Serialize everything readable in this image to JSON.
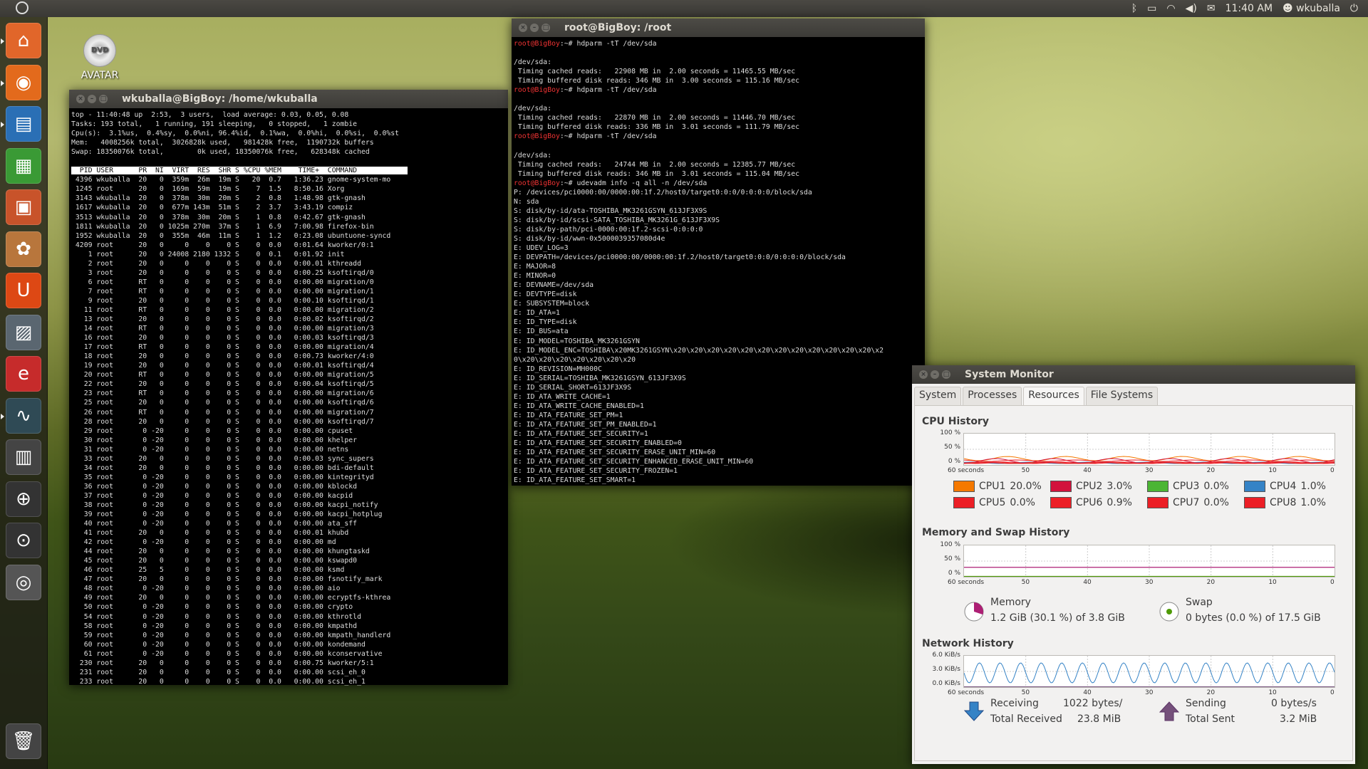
{
  "top_panel": {
    "time": "11:40 AM",
    "user": "wkuballa",
    "icons": [
      "bluetooth-icon",
      "battery-icon",
      "wifi-icon",
      "volume-icon",
      "mail-icon",
      "user-icon",
      "power-icon"
    ]
  },
  "desktop": {
    "dvd_label": "AVATAR",
    "dvd_badge": "DVD"
  },
  "term_top": {
    "title": "wkuballa@BigBoy: /home/wkuballa",
    "summary": [
      "top - 11:40:48 up  2:53,  3 users,  load average: 0.03, 0.05, 0.08",
      "Tasks: 193 total,   1 running, 191 sleeping,   0 stopped,   1 zombie",
      "Cpu(s):  3.1%us,  0.4%sy,  0.0%ni, 96.4%id,  0.1%wa,  0.0%hi,  0.0%si,  0.0%st",
      "Mem:   4008256k total,  3026828k used,   981428k free,  1190732k buffers",
      "Swap: 18350076k total,        0k used, 18350076k free,   628348k cached"
    ],
    "header": "  PID USER      PR  NI  VIRT  RES  SHR S %CPU %MEM    TIME+  COMMAND            ",
    "rows": [
      " 4396 wkuballa  20   0  359m  26m  19m S   20  0.7   1:36.23 gnome-system-mo",
      " 1245 root      20   0  169m  59m  19m S    7  1.5   8:50.16 Xorg",
      " 3143 wkuballa  20   0  378m  30m  20m S    2  0.8   1:48.98 gtk-gnash",
      " 1617 wkuballa  20   0  677m 143m  51m S    2  3.7   3:43.19 compiz",
      " 3513 wkuballa  20   0  378m  30m  20m S    1  0.8   0:42.67 gtk-gnash",
      " 1811 wkuballa  20   0 1025m 270m  37m S    1  6.9   7:00.98 firefox-bin",
      " 1952 wkuballa  20   0  355m  46m  11m S    1  1.2   0:23.08 ubuntuone-syncd",
      " 4209 root      20   0     0    0    0 S    0  0.0   0:01.64 kworker/0:1",
      "    1 root      20   0 24008 2180 1332 S    0  0.1   0:01.92 init",
      "    2 root      20   0     0    0    0 S    0  0.0   0:00.01 kthreadd",
      "    3 root      20   0     0    0    0 S    0  0.0   0:00.25 ksoftirqd/0",
      "    6 root      RT   0     0    0    0 S    0  0.0   0:00.00 migration/0",
      "    7 root      RT   0     0    0    0 S    0  0.0   0:00.00 migration/1",
      "    9 root      20   0     0    0    0 S    0  0.0   0:00.10 ksoftirqd/1",
      "   11 root      RT   0     0    0    0 S    0  0.0   0:00.00 migration/2",
      "   13 root      20   0     0    0    0 S    0  0.0   0:00.02 ksoftirqd/2",
      "   14 root      RT   0     0    0    0 S    0  0.0   0:00.00 migration/3",
      "   16 root      20   0     0    0    0 S    0  0.0   0:00.03 ksoftirqd/3",
      "   17 root      RT   0     0    0    0 S    0  0.0   0:00.00 migration/4",
      "   18 root      20   0     0    0    0 S    0  0.0   0:00.73 kworker/4:0",
      "   19 root      20   0     0    0    0 S    0  0.0   0:00.01 ksoftirqd/4",
      "   20 root      RT   0     0    0    0 S    0  0.0   0:00.00 migration/5",
      "   22 root      20   0     0    0    0 S    0  0.0   0:00.04 ksoftirqd/5",
      "   23 root      RT   0     0    0    0 S    0  0.0   0:00.00 migration/6",
      "   25 root      20   0     0    0    0 S    0  0.0   0:00.00 ksoftirqd/6",
      "   26 root      RT   0     0    0    0 S    0  0.0   0:00.00 migration/7",
      "   28 root      20   0     0    0    0 S    0  0.0   0:00.00 ksoftirqd/7",
      "   29 root       0 -20     0    0    0 S    0  0.0   0:00.00 cpuset",
      "   30 root       0 -20     0    0    0 S    0  0.0   0:00.00 khelper",
      "   31 root       0 -20     0    0    0 S    0  0.0   0:00.00 netns",
      "   33 root      20   0     0    0    0 S    0  0.0   0:00.03 sync_supers",
      "   34 root      20   0     0    0    0 S    0  0.0   0:00.00 bdi-default",
      "   35 root       0 -20     0    0    0 S    0  0.0   0:00.00 kintegrityd",
      "   36 root       0 -20     0    0    0 S    0  0.0   0:00.00 kblockd",
      "   37 root       0 -20     0    0    0 S    0  0.0   0:00.00 kacpid",
      "   38 root       0 -20     0    0    0 S    0  0.0   0:00.00 kacpi_notify",
      "   39 root       0 -20     0    0    0 S    0  0.0   0:00.00 kacpi_hotplug",
      "   40 root       0 -20     0    0    0 S    0  0.0   0:00.00 ata_sff",
      "   41 root      20   0     0    0    0 S    0  0.0   0:00.01 khubd",
      "   42 root       0 -20     0    0    0 S    0  0.0   0:00.00 md",
      "   44 root      20   0     0    0    0 S    0  0.0   0:00.00 khungtaskd",
      "   45 root      20   0     0    0    0 S    0  0.0   0:00.00 kswapd0",
      "   46 root      25   5     0    0    0 S    0  0.0   0:00.00 ksmd",
      "   47 root      20   0     0    0    0 S    0  0.0   0:00.00 fsnotify_mark",
      "   48 root       0 -20     0    0    0 S    0  0.0   0:00.00 aio",
      "   49 root      20   0     0    0    0 S    0  0.0   0:00.00 ecryptfs-kthrea",
      "   50 root       0 -20     0    0    0 S    0  0.0   0:00.00 crypto",
      "   54 root       0 -20     0    0    0 S    0  0.0   0:00.00 kthrotld",
      "   58 root       0 -20     0    0    0 S    0  0.0   0:00.00 kmpathd",
      "   59 root       0 -20     0    0    0 S    0  0.0   0:00.00 kmpath_handlerd",
      "   60 root       0 -20     0    0    0 S    0  0.0   0:00.00 kondemand",
      "   61 root       0 -20     0    0    0 S    0  0.0   0:00.00 kconservative",
      "  230 root      20   0     0    0    0 S    0  0.0   0:00.75 kworker/5:1",
      "  231 root      20   0     0    0    0 S    0  0.0   0:00.00 scsi_eh_0",
      "  233 root      20   0     0    0    0 S    0  0.0   0:00.00 scsi_eh_1"
    ]
  },
  "term_root": {
    "title": "root@BigBoy: /root",
    "prompt_user": "root",
    "prompt_host": "BigBoy",
    "prompt_suffix": ":~# ",
    "lines": [
      {
        "prompt": true,
        "text": "hdparm -tT /dev/sda"
      },
      {
        "prompt": false,
        "text": ""
      },
      {
        "prompt": false,
        "text": "/dev/sda:"
      },
      {
        "prompt": false,
        "text": " Timing cached reads:   22908 MB in  2.00 seconds = 11465.55 MB/sec"
      },
      {
        "prompt": false,
        "text": " Timing buffered disk reads: 346 MB in  3.00 seconds = 115.16 MB/sec"
      },
      {
        "prompt": true,
        "text": "hdparm -tT /dev/sda"
      },
      {
        "prompt": false,
        "text": ""
      },
      {
        "prompt": false,
        "text": "/dev/sda:"
      },
      {
        "prompt": false,
        "text": " Timing cached reads:   22870 MB in  2.00 seconds = 11446.70 MB/sec"
      },
      {
        "prompt": false,
        "text": " Timing buffered disk reads: 336 MB in  3.01 seconds = 111.79 MB/sec"
      },
      {
        "prompt": true,
        "text": "hdparm -tT /dev/sda"
      },
      {
        "prompt": false,
        "text": ""
      },
      {
        "prompt": false,
        "text": "/dev/sda:"
      },
      {
        "prompt": false,
        "text": " Timing cached reads:   24744 MB in  2.00 seconds = 12385.77 MB/sec"
      },
      {
        "prompt": false,
        "text": " Timing buffered disk reads: 346 MB in  3.01 seconds = 115.04 MB/sec"
      },
      {
        "prompt": true,
        "text": "udevadm info -q all -n /dev/sda"
      },
      {
        "prompt": false,
        "text": "P: /devices/pci0000:00/0000:00:1f.2/host0/target0:0:0/0:0:0:0/block/sda"
      },
      {
        "prompt": false,
        "text": "N: sda"
      },
      {
        "prompt": false,
        "text": "S: disk/by-id/ata-TOSHIBA_MK3261GSYN_613JF3X9S"
      },
      {
        "prompt": false,
        "text": "S: disk/by-id/scsi-SATA_TOSHIBA_MK3261G_613JF3X9S"
      },
      {
        "prompt": false,
        "text": "S: disk/by-path/pci-0000:00:1f.2-scsi-0:0:0:0"
      },
      {
        "prompt": false,
        "text": "S: disk/by-id/wwn-0x5000039357080d4e"
      },
      {
        "prompt": false,
        "text": "E: UDEV_LOG=3"
      },
      {
        "prompt": false,
        "text": "E: DEVPATH=/devices/pci0000:00/0000:00:1f.2/host0/target0:0:0/0:0:0:0/block/sda"
      },
      {
        "prompt": false,
        "text": "E: MAJOR=8"
      },
      {
        "prompt": false,
        "text": "E: MINOR=0"
      },
      {
        "prompt": false,
        "text": "E: DEVNAME=/dev/sda"
      },
      {
        "prompt": false,
        "text": "E: DEVTYPE=disk"
      },
      {
        "prompt": false,
        "text": "E: SUBSYSTEM=block"
      },
      {
        "prompt": false,
        "text": "E: ID_ATA=1"
      },
      {
        "prompt": false,
        "text": "E: ID_TYPE=disk"
      },
      {
        "prompt": false,
        "text": "E: ID_BUS=ata"
      },
      {
        "prompt": false,
        "text": "E: ID_MODEL=TOSHIBA_MK3261GSYN"
      },
      {
        "prompt": false,
        "text": "E: ID_MODEL_ENC=TOSHIBA\\x20MK3261GSYN\\x20\\x20\\x20\\x20\\x20\\x20\\x20\\x20\\x20\\x20\\x20\\x20\\x2"
      },
      {
        "prompt": false,
        "text": "0\\x20\\x20\\x20\\x20\\x20\\x20\\x20"
      },
      {
        "prompt": false,
        "text": "E: ID_REVISION=MH000C"
      },
      {
        "prompt": false,
        "text": "E: ID_SERIAL=TOSHIBA_MK3261GSYN_613JF3X9S"
      },
      {
        "prompt": false,
        "text": "E: ID_SERIAL_SHORT=613JF3X9S"
      },
      {
        "prompt": false,
        "text": "E: ID_ATA_WRITE_CACHE=1"
      },
      {
        "prompt": false,
        "text": "E: ID_ATA_WRITE_CACHE_ENABLED=1"
      },
      {
        "prompt": false,
        "text": "E: ID_ATA_FEATURE_SET_PM=1"
      },
      {
        "prompt": false,
        "text": "E: ID_ATA_FEATURE_SET_PM_ENABLED=1"
      },
      {
        "prompt": false,
        "text": "E: ID_ATA_FEATURE_SET_SECURITY=1"
      },
      {
        "prompt": false,
        "text": "E: ID_ATA_FEATURE_SET_SECURITY_ENABLED=0"
      },
      {
        "prompt": false,
        "text": "E: ID_ATA_FEATURE_SET_SECURITY_ERASE_UNIT_MIN=60"
      },
      {
        "prompt": false,
        "text": "E: ID_ATA_FEATURE_SET_SECURITY_ENHANCED_ERASE_UNIT_MIN=60"
      },
      {
        "prompt": false,
        "text": "E: ID_ATA_FEATURE_SET_SECURITY_FROZEN=1"
      },
      {
        "prompt": false,
        "text": "E: ID_ATA_FEATURE_SET_SMART=1"
      }
    ]
  },
  "sysmon": {
    "title": "System Monitor",
    "tabs": [
      "System",
      "Processes",
      "Resources",
      "File Systems"
    ],
    "active_tab": "Resources",
    "cpu_history": {
      "title": "CPU History",
      "y_ticks": [
        "100 %",
        "50 %",
        "0 %"
      ],
      "x_ticks": [
        "60 seconds",
        "50",
        "40",
        "30",
        "20",
        "10",
        "0"
      ],
      "legend": [
        {
          "name": "CPU1",
          "value": "20.0%",
          "color": "#f57900"
        },
        {
          "name": "CPU2",
          "value": "3.0%",
          "color": "#d2123c"
        },
        {
          "name": "CPU3",
          "value": "0.0%",
          "color": "#4bb534"
        },
        {
          "name": "CPU4",
          "value": "1.0%",
          "color": "#3583c6"
        },
        {
          "name": "CPU5",
          "value": "0.0%",
          "color": "#ec1f26"
        },
        {
          "name": "CPU6",
          "value": "0.9%",
          "color": "#ec1f26"
        },
        {
          "name": "CPU7",
          "value": "0.0%",
          "color": "#ec1f26"
        },
        {
          "name": "CPU8",
          "value": "1.0%",
          "color": "#ec1f26"
        }
      ]
    },
    "mem_history": {
      "title": "Memory and Swap History",
      "y_ticks": [
        "100 %",
        "50 %",
        "0 %"
      ],
      "x_ticks": [
        "60 seconds",
        "50",
        "40",
        "30",
        "20",
        "10",
        "0"
      ],
      "memory_label": "Memory",
      "memory_value": "1.2 GiB (30.1 %) of 3.8 GiB",
      "memory_fraction": 0.301,
      "swap_label": "Swap",
      "swap_value": "0 bytes (0.0 %) of 17.5 GiB",
      "swap_fraction": 0.0,
      "memory_color": "#ad1f74",
      "swap_color": "#4e9a06"
    },
    "net_history": {
      "title": "Network History",
      "y_ticks": [
        "6.0 KiB/s",
        "3.0 KiB/s",
        "0.0 KiB/s"
      ],
      "x_ticks": [
        "60 seconds",
        "50",
        "40",
        "30",
        "20",
        "10",
        "0"
      ],
      "receiving_label": "Receiving",
      "receiving_value": "1022 bytes/",
      "total_received_label": "Total Received",
      "total_received_value": "23.8 MiB",
      "sending_label": "Sending",
      "sending_value": "0 bytes/s",
      "total_sent_label": "Total Sent",
      "total_sent_value": "3.2 MiB",
      "receiving_color": "#3583c6",
      "sending_color": "#75507b"
    }
  },
  "launcher": {
    "items": [
      {
        "name": "home-folder-icon",
        "glyph": "⌂",
        "color": "#e1662a"
      },
      {
        "name": "firefox-icon",
        "glyph": "◉",
        "color": "#e36a1c"
      },
      {
        "name": "writer-icon",
        "glyph": "▤",
        "color": "#2a6fb5"
      },
      {
        "name": "calc-icon",
        "glyph": "▦",
        "color": "#3a9a35"
      },
      {
        "name": "impress-icon",
        "glyph": "▣",
        "color": "#c8532a"
      },
      {
        "name": "software-center-icon",
        "glyph": "✿",
        "color": "#b8763c"
      },
      {
        "name": "ubuntu-one-icon",
        "glyph": "U",
        "color": "#dd4814"
      },
      {
        "name": "image-editor-icon",
        "glyph": "▨",
        "color": "#5a6670"
      },
      {
        "name": "text-editor-icon",
        "glyph": "e",
        "color": "#c62b2b"
      },
      {
        "name": "system-monitor-icon",
        "glyph": "∿",
        "color": "#2f4a55"
      },
      {
        "name": "workspace-switcher-icon",
        "glyph": "▥",
        "color": "#444"
      },
      {
        "name": "search-apps-icon",
        "glyph": "⊕",
        "color": "#333"
      },
      {
        "name": "search-files-icon",
        "glyph": "⊙",
        "color": "#333"
      },
      {
        "name": "dvd-launcher-icon",
        "glyph": "◎",
        "color": "#555"
      },
      {
        "name": "trash-icon",
        "glyph": "🗑",
        "color": "#444"
      }
    ]
  }
}
